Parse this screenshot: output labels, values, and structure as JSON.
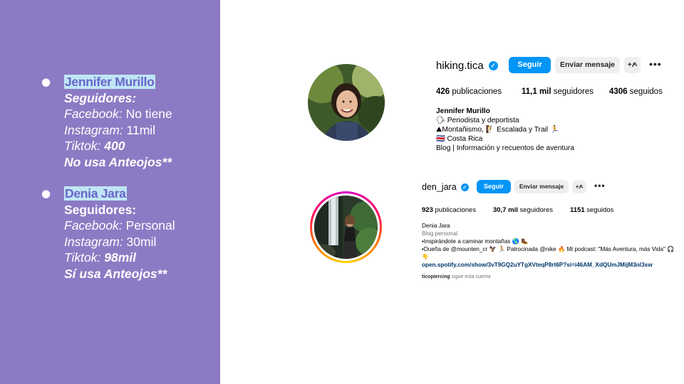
{
  "left_panel": {
    "color": "#8c7bc4",
    "people": [
      {
        "name": "Jennifer Murillo",
        "followers_label": "Seguidores:",
        "facebook_label": "Facebook:",
        "facebook_value": " No tiene",
        "instagram_label": "Instagram:",
        "instagram_value": " 11mil",
        "tiktok_label": "Tiktok:",
        "tiktok_value": " 400",
        "glasses": "No usa Anteojos**"
      },
      {
        "name": "Denia Jara",
        "followers_label": "Seguidores:",
        "facebook_label": "Facebook:",
        "facebook_value": " Personal",
        "instagram_label": "Instagram:",
        "instagram_value": " 30mil",
        "tiktok_label": "Tiktok:",
        "tiktok_value": " 98mil",
        "glasses": "Sí usa Anteojos**"
      }
    ]
  },
  "profile1": {
    "username": "hiking.tica",
    "verified_icon": "✓",
    "follow_button": "Seguir",
    "message_button": "Enviar mensaje",
    "add_user_icon": "+ዶ",
    "more_icon": "•••",
    "stats": {
      "posts_count": "426",
      "posts_label": " publicaciones",
      "followers_count": "11,1 mil",
      "followers_label": " seguidores",
      "following_count": "4306",
      "following_label": " seguidos"
    },
    "bio": [
      "Jennifer Murillo",
      "🗣 Periodista y deportista",
      "⛰Montañismo, 🧗 Escalada y Trail 🏃",
      "🇨🇷 Costa Rica",
      "Blog | Información y recuentos de aventura"
    ]
  },
  "profile2": {
    "username": "den_jara",
    "verified_icon": "✓",
    "follow_button": "Seguir",
    "message_button": "Enviar mensaje",
    "add_user_icon": "+ዶ",
    "more_icon": "•••",
    "stats": {
      "posts_count": "923",
      "posts_label": " publicaciones",
      "followers_count": "30,7 mil",
      "followers_label": " seguidores",
      "following_count": "1151",
      "following_label": " seguidos"
    },
    "bio": [
      "Denia Jara",
      "Blog personal",
      "•Inspirándote a caminar montañas 🌎 🥾",
      "•Dueña de @mounten_cr 🦅 🏃 Patrocinada @nike 🔥 Mi podcast: \"Más Aventura, más Vida\" 🎧",
      "👇"
    ],
    "bio_category": "Blog personal",
    "link": "open.spotify.com/show/3vT9GQ2uYTgXVteqP8rt6P?si=i46AM_XdQUmJMijM3nl3sw",
    "followed_by_user": "ticopiercing",
    "followed_by_text": " sigue esta cuenta"
  }
}
